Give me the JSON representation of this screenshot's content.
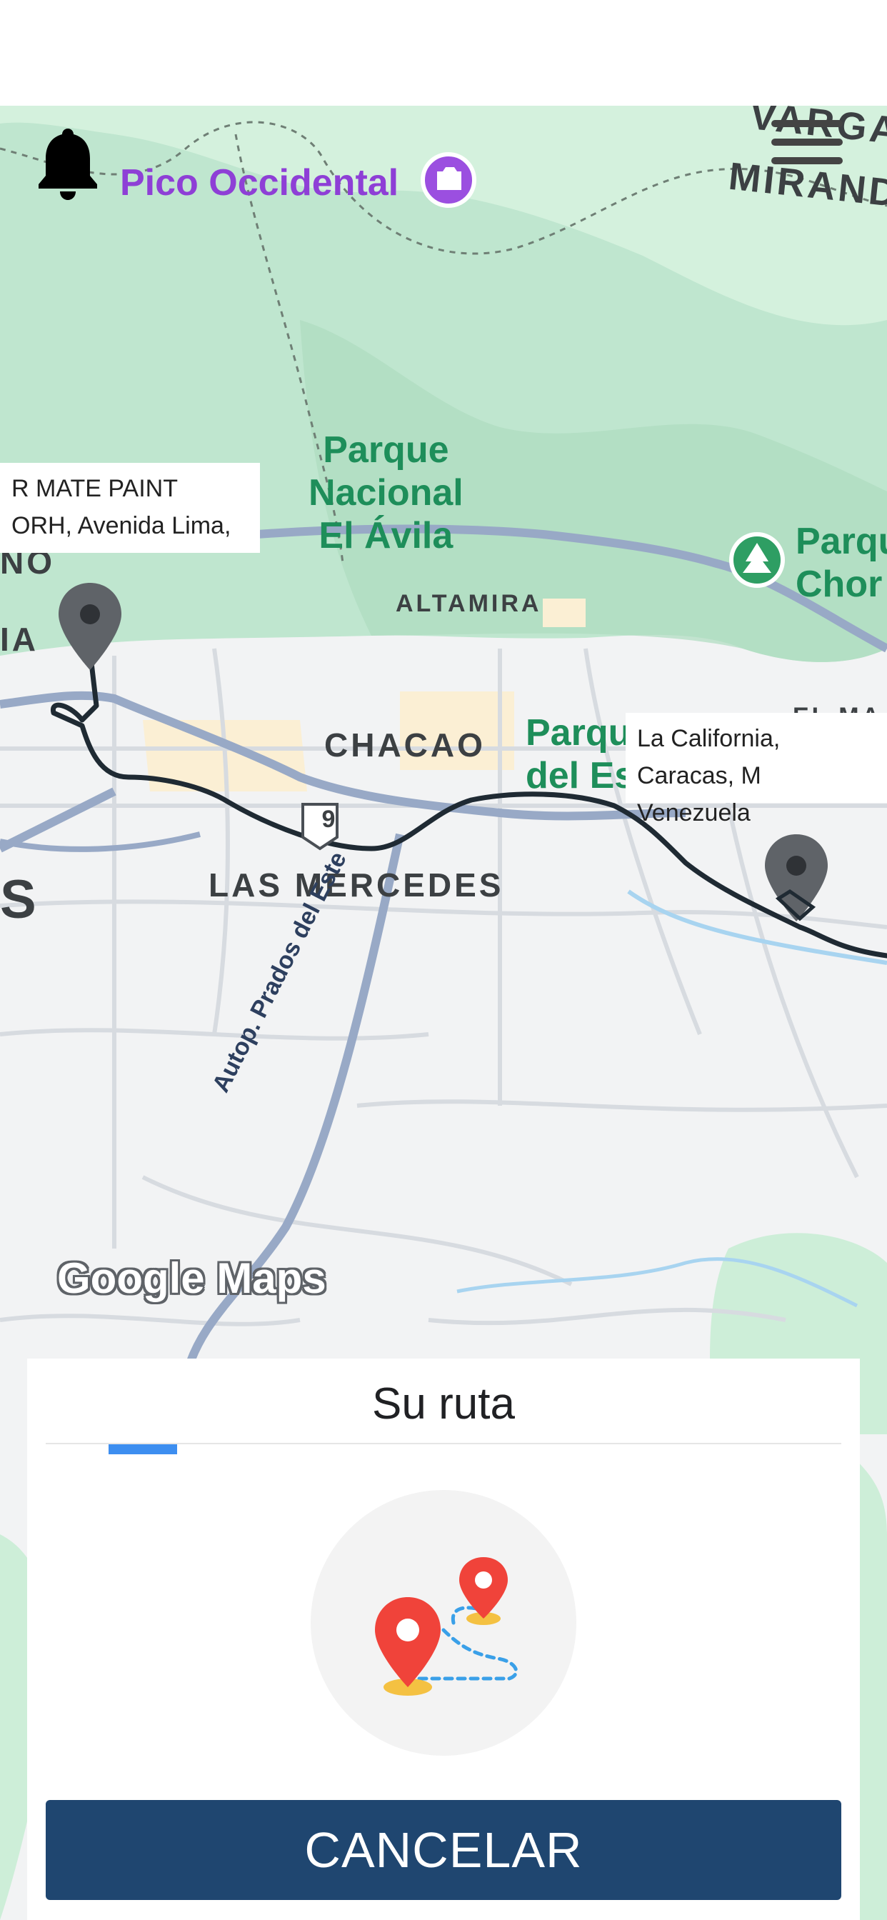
{
  "map": {
    "poi": "Pico Occidental",
    "park_avila": [
      "Parque",
      "Nacional",
      "El Ávila"
    ],
    "park_chorros": [
      "Parque",
      "Chor"
    ],
    "park_este": [
      "Parqu",
      "del Es"
    ],
    "districts": {
      "altamira": "ALTAMIRA",
      "chacao": "CHACAO",
      "las_mercedes": "LAS MERCEDES",
      "top_right_1": "VARGA",
      "top_right_2": "MIRAND",
      "edge_no": "NO",
      "edge_ia": "IA",
      "edge_s": "S",
      "edge_elm": "EL MA"
    },
    "highway_shield": "9",
    "highway_name": "Autop. Prados del Este",
    "attribution": "Google Maps"
  },
  "origin_info": {
    "line1": "R MATE PAINT",
    "line2": "ORH, Avenida Lima,"
  },
  "destination_info": {
    "line1": "La California, Caracas, M",
    "line2": "Venezuela"
  },
  "icons": {
    "bell": "bell-icon",
    "menu": "hamburger-menu-icon",
    "route": "route-map-icon"
  },
  "panel": {
    "title": "Su ruta",
    "cancel_label": "CANCELAR"
  },
  "colors": {
    "accent": "#3d8ef0",
    "button": "#1f4670",
    "route": "#1f2a33"
  }
}
